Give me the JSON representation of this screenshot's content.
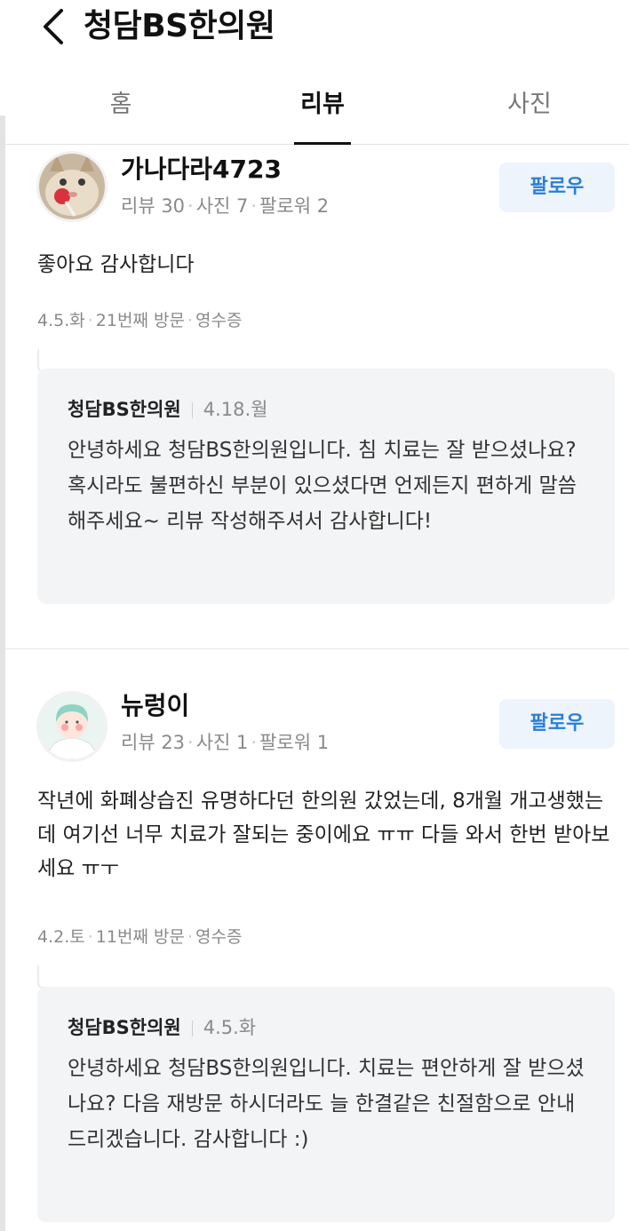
{
  "header": {
    "title": "청담BS한의원",
    "back_icon": "chevron-left-icon"
  },
  "tabs": [
    {
      "label": "홈",
      "active": false
    },
    {
      "label": "리뷰",
      "active": true
    },
    {
      "label": "사진",
      "active": false
    }
  ],
  "reviews": [
    {
      "user": {
        "name": "가나다라4723",
        "avatar": "cat-photo-avatar",
        "stats": {
          "reviews": "리뷰 30",
          "photos": "사진 7",
          "followers": "팔로워 2"
        }
      },
      "follow_label": "팔로우",
      "text": "좋아요 감사합니다",
      "meta": {
        "date": "4.5.화",
        "visit": "21번째 방문",
        "receipt": "영수증"
      },
      "reply": {
        "business": "청담BS한의원",
        "date": "4.18.월",
        "text": "안녕하세요 청담BS한의원입니다. 침 치료는 잘 받으셨나요? 혹시라도 불편하신 부분이 있으셨다면 언제든지 편하게 말씀해주세요~ 리뷰 작성해주셔서 감사합니다!"
      }
    },
    {
      "user": {
        "name": "뉴렁이",
        "avatar": "illustrated-person-avatar",
        "stats": {
          "reviews": "리뷰 23",
          "photos": "사진 1",
          "followers": "팔로워 1"
        }
      },
      "follow_label": "팔로우",
      "text": "작년에 화폐상습진 유명하다던 한의원 갔었는데, 8개월 개고생했는데 여기선 너무 치료가 잘되는 중이에요 ㅠㅠ 다들 와서 한번 받아보세요 ㅠㅜ",
      "meta": {
        "date": "4.2.토",
        "visit": "11번째 방문",
        "receipt": "영수증"
      },
      "reply": {
        "business": "청담BS한의원",
        "date": "4.5.화",
        "text": "안녕하세요 청담BS한의원입니다. 치료는 편안하게 잘 받으셨나요? 다음 재방문 하시더라도 늘 한결같은 친절함으로 안내드리겠습니다. 감사합니다 :)"
      }
    }
  ],
  "colors": {
    "accent": "#2a7fd8",
    "follow_bg": "#eef4fb",
    "reply_bg": "#f2f4f5",
    "muted_text": "#8a8a8a"
  }
}
